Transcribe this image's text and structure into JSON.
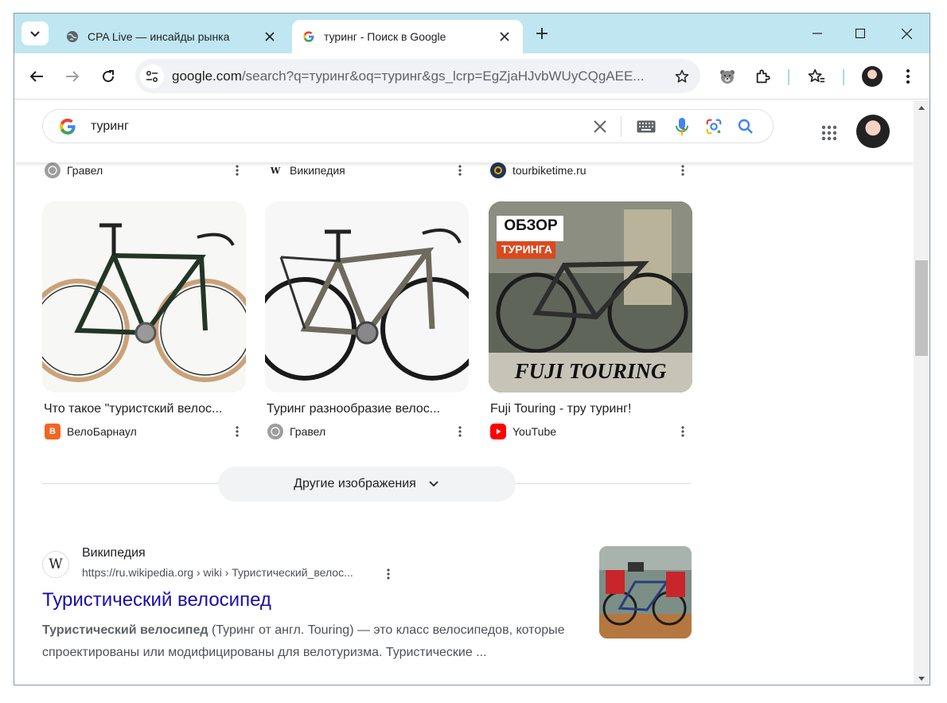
{
  "browser": {
    "tabs": [
      {
        "title": "CPA Live — инсайды рынка",
        "active": false
      },
      {
        "title": "туринг - Поиск в Google",
        "active": true
      }
    ],
    "url": {
      "host": "google.com",
      "path": "/search?q=туринг&oq=туринг&gs_lcrp=EgZjaHJvbWUyCQgAEE..."
    }
  },
  "google": {
    "query": "туринг"
  },
  "images": {
    "top_sources": [
      {
        "name": "Гравел"
      },
      {
        "name": "Википедия"
      },
      {
        "name": "tourbiketime.ru"
      }
    ],
    "cards": [
      {
        "caption": "Что такое \"туристский велос...",
        "source": "ВелоБарнаул"
      },
      {
        "caption": "Туринг разнообразие велос...",
        "source": "Гравел"
      },
      {
        "caption": "Fuji Touring - тру туринг!",
        "source": "YouTube",
        "overlay_top": "ОБЗОР",
        "overlay_sub": "ТУРИНГА",
        "overlay_bottom": "FUJI TOURING"
      }
    ],
    "more_button": "Другие изображения"
  },
  "result": {
    "site": "Википедия",
    "cite": "https://ru.wikipedia.org › wiki › Туристический_велос...",
    "title": "Туристический велосипед",
    "snippet_bold": "Туристический велосипед",
    "snippet_rest": " (Туринг от англ. Touring) — это класс велосипедов, которые спроектированы или модифицированы для велотуризма. Туристические ..."
  },
  "colors": {
    "tabstrip": "#bfe6f1",
    "link": "#1a0dab",
    "youtube": "#ff0000",
    "velobarnaul": "#f26522"
  },
  "icons": {
    "wiki_letter": "W"
  }
}
